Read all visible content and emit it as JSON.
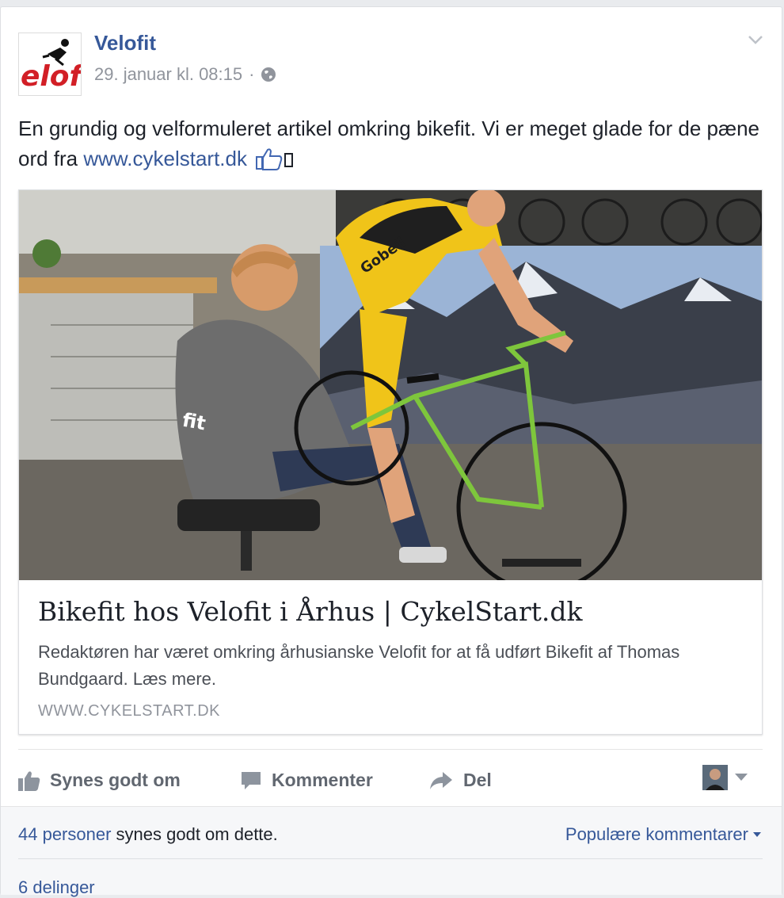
{
  "post": {
    "page_name": "Velofit",
    "timestamp": "29. januar kl. 08:15",
    "separator": "·",
    "text_before_link": "En grundig og velformuleret artikel omkring bikefit. Vi er meget glade for de pæne ord fra ",
    "link_text": "www.cykelstart.dk",
    "avatar_logo_text": "elofit",
    "privacy_icon": "globe-icon",
    "options_icon": "chevron-down-icon"
  },
  "link_preview": {
    "title": "Bikefit hos Velofit i Århus | CykelStart.dk",
    "description": "Redaktøren har været omkring århusianske Velofit for at få udført Bikefit af Thomas Bundgaard. Læs mere.",
    "domain": "WWW.CYKELSTART.DK",
    "image_hoodie_text": "fit",
    "image_jersey_text": "Gobeil"
  },
  "actions": {
    "like_label": "Synes godt om",
    "comment_label": "Kommenter",
    "share_label": "Del"
  },
  "footer": {
    "likes_count_link": "44 personer",
    "likes_suffix": " synes godt om dette.",
    "sort_label": "Populære kommentarer",
    "shares_label": "6 delinger"
  },
  "colors": {
    "link": "#365899",
    "muted": "#90949c",
    "action_gray": "#616770",
    "brand_red": "#d21f26"
  }
}
